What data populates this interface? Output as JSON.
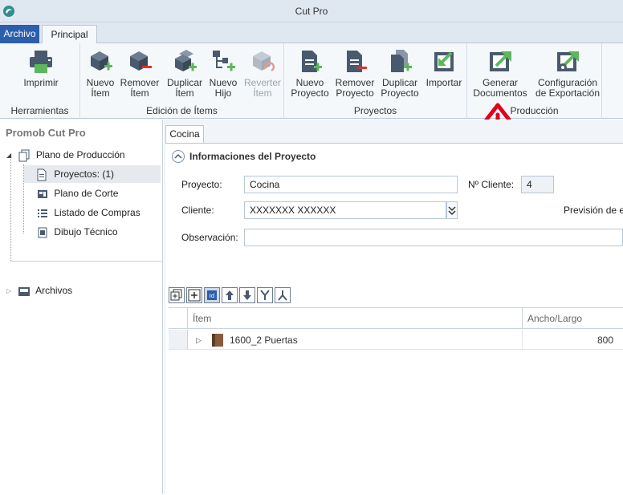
{
  "window": {
    "title": "Cut Pro"
  },
  "menu": {
    "archivo_label": "Archivo"
  },
  "tabs": [
    {
      "label": "Principal"
    }
  ],
  "ribbon": {
    "groups": [
      {
        "label": "Herramientas",
        "buttons": [
          {
            "label1": "Imprimir",
            "label2": ""
          }
        ]
      },
      {
        "label": "Edición de Ítems",
        "buttons": [
          {
            "label1": "Nuevo",
            "label2": "Ítem"
          },
          {
            "label1": "Remover",
            "label2": "Ítem"
          },
          {
            "label1": "Duplicar",
            "label2": "Ítem"
          },
          {
            "label1": "Nuevo",
            "label2": "Hijo"
          },
          {
            "label1": "Reverter",
            "label2": "Ítem"
          }
        ]
      },
      {
        "label": "Proyectos",
        "buttons": [
          {
            "label1": "Nuevo",
            "label2": "Proyecto"
          },
          {
            "label1": "Remover",
            "label2": "Proyecto"
          },
          {
            "label1": "Duplicar",
            "label2": "Proyecto"
          },
          {
            "label1": "Importar",
            "label2": ""
          }
        ]
      },
      {
        "label": "Producción",
        "buttons": [
          {
            "label1": "Generar",
            "label2": "Documentos"
          },
          {
            "label1": "Configuración",
            "label2": "de Exportación"
          }
        ]
      }
    ]
  },
  "sidebar": {
    "title": "Promob Cut Pro",
    "items": [
      {
        "label": "Plano de Producción"
      },
      {
        "label": "Proyectos: (1)"
      },
      {
        "label": "Plano de Corte"
      },
      {
        "label": "Listado de Compras"
      },
      {
        "label": "Dibujo Técnico"
      },
      {
        "label": "Archivos"
      }
    ]
  },
  "document": {
    "tab_label": "Cocina",
    "section_title": "Informaciones del Proyecto",
    "fields": {
      "proyecto_label": "Proyecto:",
      "proyecto_value": "Cocina",
      "ncliente_label": "Nº Cliente:",
      "ncliente_value": "4",
      "cliente_label": "Cliente:",
      "cliente_value": "XXXXXXX XXXXXX",
      "prevision_label": "Previsión de e",
      "observacion_label": "Observación:",
      "observacion_value": ""
    },
    "grid": {
      "columns": [
        "Ítem",
        "Ancho/Largo"
      ],
      "rows": [
        {
          "item": "1600_2 Puertas",
          "ancho_largo": "800"
        }
      ]
    }
  },
  "colors": {
    "accent": "#2b5fad",
    "green": "#5cb85c",
    "red_arrow": "#e2001a",
    "icon_dark": "#4a5a6e"
  }
}
